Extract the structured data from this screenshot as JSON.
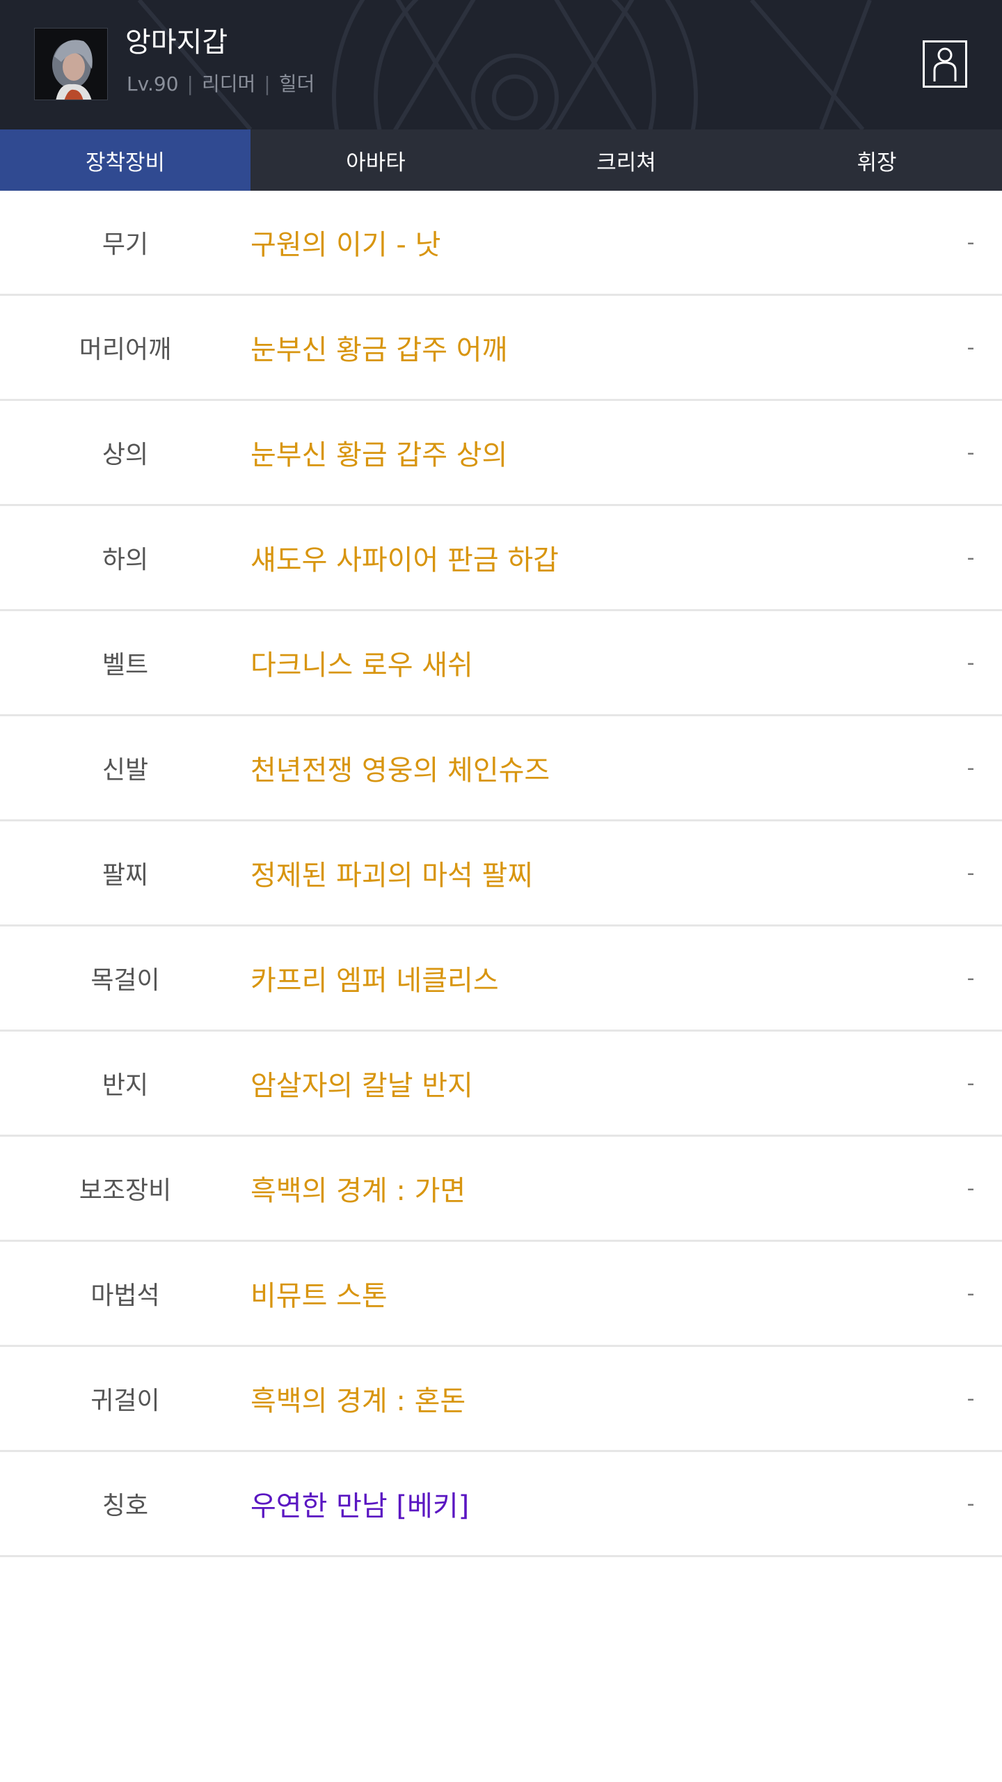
{
  "header": {
    "character_name": "앙마지갑",
    "level": "Lv.90",
    "server": "리디머",
    "job": "힐더",
    "separator": "|",
    "avatar_icon": "character-portrait",
    "profile_icon": "person-icon"
  },
  "tabs": [
    {
      "label": "장착장비",
      "active": true
    },
    {
      "label": "아바타",
      "active": false
    },
    {
      "label": "크리쳐",
      "active": false
    },
    {
      "label": "휘장",
      "active": false
    }
  ],
  "equipment": [
    {
      "slot": "무기",
      "item": "구원의 이기 - 낫",
      "value": "-",
      "color": "#d8950f"
    },
    {
      "slot": "머리어깨",
      "item": "눈부신 황금 갑주 어깨",
      "value": "-",
      "color": "#d8950f"
    },
    {
      "slot": "상의",
      "item": "눈부신 황금 갑주 상의",
      "value": "-",
      "color": "#d8950f"
    },
    {
      "slot": "하의",
      "item": "섀도우 사파이어 판금 하갑",
      "value": "-",
      "color": "#d8950f"
    },
    {
      "slot": "벨트",
      "item": "다크니스 로우 새쉬",
      "value": "-",
      "color": "#d8950f"
    },
    {
      "slot": "신발",
      "item": "천년전쟁 영웅의 체인슈즈",
      "value": "-",
      "color": "#d8950f"
    },
    {
      "slot": "팔찌",
      "item": "정제된 파괴의 마석 팔찌",
      "value": "-",
      "color": "#d8950f"
    },
    {
      "slot": "목걸이",
      "item": "카프리 엠퍼 네클리스",
      "value": "-",
      "color": "#d8950f"
    },
    {
      "slot": "반지",
      "item": "암살자의 칼날 반지",
      "value": "-",
      "color": "#d8950f"
    },
    {
      "slot": "보조장비",
      "item": "흑백의 경계 : 가면",
      "value": "-",
      "color": "#d8950f"
    },
    {
      "slot": "마법석",
      "item": "비뮤트 스톤",
      "value": "-",
      "color": "#d8950f"
    },
    {
      "slot": "귀걸이",
      "item": "흑백의 경계 : 혼돈",
      "value": "-",
      "color": "#d8950f"
    },
    {
      "slot": "칭호",
      "item": "우연한 만남 [베키]",
      "value": "-",
      "color": "#5a16c2"
    }
  ],
  "colors": {
    "header_bg": "#1f232d",
    "tab_bar_bg": "#2a2e38",
    "active_tab": "#304a91",
    "epic_item": "#d8950f",
    "title_item": "#5a16c2"
  }
}
